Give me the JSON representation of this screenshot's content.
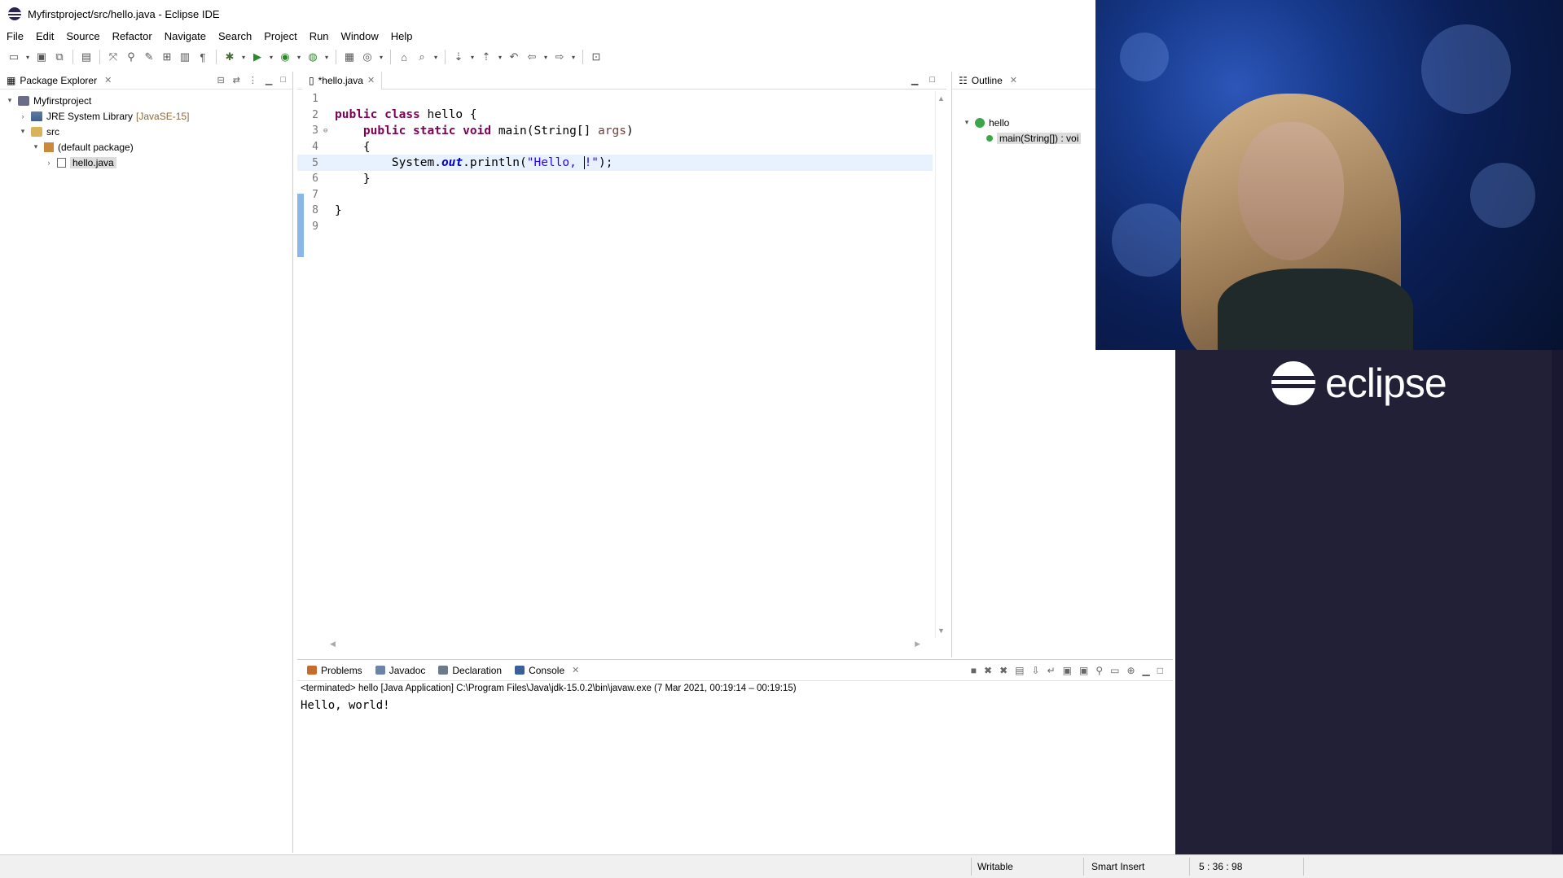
{
  "window": {
    "title": "Myfirstproject/src/hello.java - Eclipse IDE"
  },
  "menubar": [
    "File",
    "Edit",
    "Source",
    "Refactor",
    "Navigate",
    "Search",
    "Project",
    "Run",
    "Window",
    "Help"
  ],
  "package_explorer": {
    "tab_label": "Package Explorer",
    "tree": [
      {
        "label": "Myfirstproject",
        "sub": "",
        "icon": "project-icon",
        "expanded": "▾",
        "indent": 0
      },
      {
        "label": "JRE System Library",
        "sub": "[JavaSE-15]",
        "icon": "library-icon",
        "expanded": "›",
        "indent": 1
      },
      {
        "label": "src",
        "sub": "",
        "icon": "source-folder-icon",
        "expanded": "▾",
        "indent": 1
      },
      {
        "label": "(default package)",
        "sub": "",
        "icon": "package-icon",
        "expanded": "▾",
        "indent": 2
      },
      {
        "label": "hello.java",
        "sub": "",
        "icon": "java-file-icon",
        "expanded": "›",
        "indent": 3
      }
    ]
  },
  "editor": {
    "tab_label": "*hello.java",
    "current_line": 5,
    "lines": [
      {
        "n": "1",
        "fold": "",
        "html": ""
      },
      {
        "n": "2",
        "fold": "",
        "html": "<span class=\"kw\">public</span> <span class=\"kw\">class</span> hello {"
      },
      {
        "n": "3",
        "fold": "⊖",
        "html": "    <span class=\"kw\">public</span> <span class=\"kw\">static</span> <span class=\"kw\">void</span> main(String[] <span class=\"param\">args</span>)"
      },
      {
        "n": "4",
        "fold": "",
        "html": "    {"
      },
      {
        "n": "5",
        "fold": "",
        "html": "        System.<span class=\"fld\">out</span>.println(<span class=\"str\">\"Hello, </span><span class=\"caret\"></span><span class=\"str\">!\"</span>);"
      },
      {
        "n": "6",
        "fold": "",
        "html": "    }"
      },
      {
        "n": "7",
        "fold": "",
        "html": ""
      },
      {
        "n": "8",
        "fold": "",
        "html": "}"
      },
      {
        "n": "9",
        "fold": "",
        "html": ""
      }
    ]
  },
  "outline": {
    "tab_label": "Outline",
    "class_name": "hello",
    "method": "main(String[]) : voi"
  },
  "console": {
    "tabs": [
      {
        "label": "Problems",
        "icon": "problems-icon",
        "color": "#c76b2d"
      },
      {
        "label": "Javadoc",
        "icon": "javadoc-icon",
        "color": "#6b84a8"
      },
      {
        "label": "Declaration",
        "icon": "declaration-icon",
        "color": "#6a7c8c"
      },
      {
        "label": "Console",
        "icon": "console-icon",
        "color": "#3a5f9a"
      }
    ],
    "terminated": "<terminated> hello [Java Application] C:\\Program Files\\Java\\jdk-15.0.2\\bin\\javaw.exe  (7 Mar 2021, 00:19:14 – 00:19:15)",
    "output": "Hello, world!"
  },
  "statusbar": {
    "writable": "Writable",
    "insert_mode": "Smart Insert",
    "position": "5 : 36 : 98"
  },
  "branding": {
    "text": "eclipse"
  }
}
